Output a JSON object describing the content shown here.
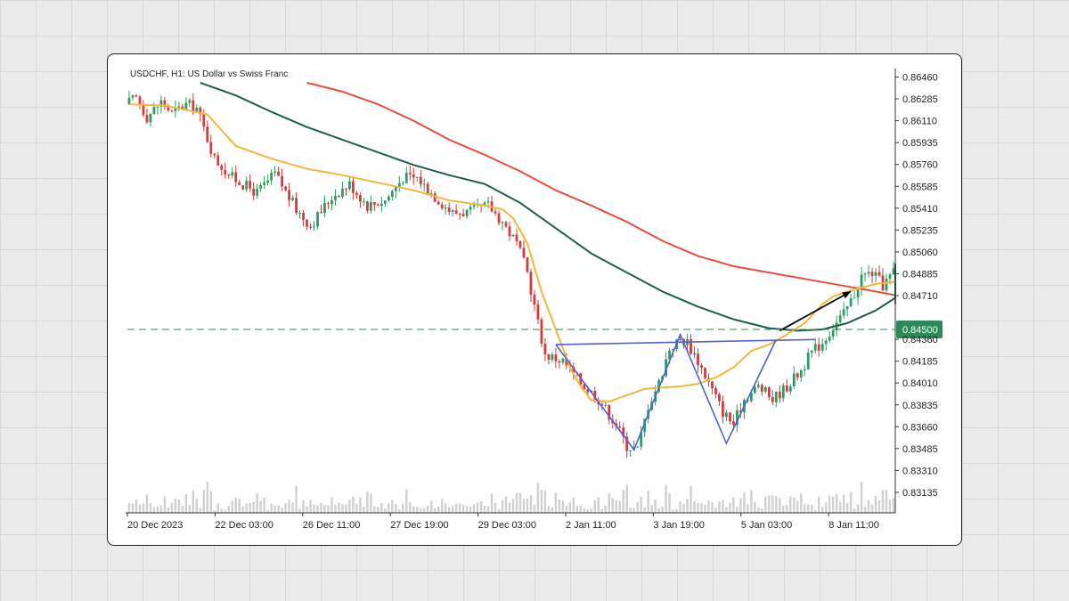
{
  "chart_data": {
    "type": "candlestick",
    "title": "USDCHF, H1: US Dollar vs Swiss Franc",
    "ylim": [
      0.8305,
      0.8652
    ],
    "y_ticks": [
      "0.86460",
      "0.86285",
      "0.86110",
      "0.85935",
      "0.85760",
      "0.85585",
      "0.85410",
      "0.85235",
      "0.85060",
      "0.84885",
      "0.84710",
      "0.84360",
      "0.84185",
      "0.84010",
      "0.83835",
      "0.83660",
      "0.83485",
      "0.83310",
      "0.83135"
    ],
    "x_ticks": [
      "20 Dec 2023",
      "22 Dec 03:00",
      "26 Dec 11:00",
      "27 Dec 19:00",
      "29 Dec 03:00",
      "2 Jan 11:00",
      "3 Jan 19:00",
      "5 Jan 03:00",
      "8 Jan 11:00"
    ],
    "n_bars": 216,
    "support_level": {
      "value": 0.845,
      "label": "0.84500",
      "color": "#2e8b57"
    },
    "colors": {
      "up": "#2e9b63",
      "down": "#d63b3b",
      "volume": "#d0d0d0",
      "ma_fast": "#f4b73a",
      "ma_mid": "#1e5e4b",
      "ma_slow": "#e84d3d",
      "pattern": "#5461d6",
      "arrow": "#000000"
    },
    "anchors": [
      [
        0,
        0.8628
      ],
      [
        3,
        0.8633
      ],
      [
        6,
        0.8618
      ],
      [
        10,
        0.863
      ],
      [
        13,
        0.8621
      ],
      [
        17,
        0.8628
      ],
      [
        20,
        0.8625
      ],
      [
        25,
        0.8585
      ],
      [
        30,
        0.857
      ],
      [
        37,
        0.8558
      ],
      [
        42,
        0.8573
      ],
      [
        48,
        0.8545
      ],
      [
        52,
        0.8532
      ],
      [
        58,
        0.8555
      ],
      [
        63,
        0.8565
      ],
      [
        68,
        0.8548
      ],
      [
        73,
        0.8552
      ],
      [
        78,
        0.857
      ],
      [
        82,
        0.857
      ],
      [
        87,
        0.8555
      ],
      [
        92,
        0.8542
      ],
      [
        97,
        0.8543
      ],
      [
        102,
        0.8548
      ],
      [
        106,
        0.8535
      ],
      [
        110,
        0.8518
      ],
      [
        113,
        0.8495
      ],
      [
        116,
        0.8455
      ],
      [
        118,
        0.843
      ],
      [
        123,
        0.8425
      ],
      [
        128,
        0.8408
      ],
      [
        133,
        0.8395
      ],
      [
        138,
        0.8375
      ],
      [
        141,
        0.8358
      ],
      [
        144,
        0.8355
      ],
      [
        147,
        0.839
      ],
      [
        150,
        0.8408
      ],
      [
        153,
        0.8435
      ],
      [
        156,
        0.8442
      ],
      [
        158,
        0.844
      ],
      [
        161,
        0.8425
      ],
      [
        164,
        0.8408
      ],
      [
        168,
        0.8385
      ],
      [
        171,
        0.8375
      ],
      [
        174,
        0.8395
      ],
      [
        178,
        0.8405
      ],
      [
        182,
        0.8395
      ],
      [
        186,
        0.8405
      ],
      [
        190,
        0.8418
      ],
      [
        193,
        0.8432
      ],
      [
        196,
        0.844
      ],
      [
        199,
        0.8452
      ],
      [
        202,
        0.8462
      ],
      [
        205,
        0.8478
      ],
      [
        207,
        0.8492
      ],
      [
        210,
        0.8495
      ],
      [
        213,
        0.8485
      ],
      [
        216,
        0.8495
      ]
    ],
    "ma_fast": [
      [
        0,
        0.8628
      ],
      [
        10,
        0.8627
      ],
      [
        22,
        0.862
      ],
      [
        30,
        0.8595
      ],
      [
        40,
        0.8585
      ],
      [
        50,
        0.8577
      ],
      [
        60,
        0.8572
      ],
      [
        70,
        0.8566
      ],
      [
        80,
        0.856
      ],
      [
        90,
        0.8552
      ],
      [
        100,
        0.8548
      ],
      [
        105,
        0.8545
      ],
      [
        108,
        0.8538
      ],
      [
        112,
        0.8518
      ],
      [
        116,
        0.848
      ],
      [
        120,
        0.845
      ],
      [
        124,
        0.842
      ],
      [
        127,
        0.8405
      ],
      [
        130,
        0.8394
      ],
      [
        135,
        0.8393
      ],
      [
        140,
        0.8398
      ],
      [
        145,
        0.8403
      ],
      [
        150,
        0.8404
      ],
      [
        155,
        0.8405
      ],
      [
        160,
        0.8407
      ],
      [
        165,
        0.8412
      ],
      [
        170,
        0.842
      ],
      [
        175,
        0.8433
      ],
      [
        180,
        0.8438
      ],
      [
        185,
        0.8446
      ],
      [
        190,
        0.8455
      ],
      [
        195,
        0.847
      ],
      [
        198,
        0.8476
      ],
      [
        202,
        0.848
      ],
      [
        206,
        0.8483
      ],
      [
        210,
        0.8486
      ],
      [
        214,
        0.8487
      ],
      [
        216,
        0.8488
      ]
    ],
    "ma_mid": [
      [
        20,
        0.8645
      ],
      [
        30,
        0.8635
      ],
      [
        40,
        0.8622
      ],
      [
        50,
        0.861
      ],
      [
        60,
        0.86
      ],
      [
        70,
        0.859
      ],
      [
        80,
        0.858
      ],
      [
        90,
        0.8572
      ],
      [
        100,
        0.8565
      ],
      [
        110,
        0.855
      ],
      [
        120,
        0.853
      ],
      [
        130,
        0.851
      ],
      [
        140,
        0.8495
      ],
      [
        150,
        0.848
      ],
      [
        160,
        0.8468
      ],
      [
        170,
        0.8458
      ],
      [
        180,
        0.8451
      ],
      [
        188,
        0.8449
      ],
      [
        195,
        0.845
      ],
      [
        202,
        0.8455
      ],
      [
        210,
        0.8465
      ],
      [
        218,
        0.8475
      ],
      [
        225,
        0.8488
      ],
      [
        232,
        0.8498
      ],
      [
        240,
        0.8502
      ]
    ],
    "ma_slow": [
      [
        50,
        0.8645
      ],
      [
        60,
        0.8638
      ],
      [
        70,
        0.8628
      ],
      [
        80,
        0.8615
      ],
      [
        90,
        0.86
      ],
      [
        100,
        0.8588
      ],
      [
        110,
        0.8575
      ],
      [
        120,
        0.856
      ],
      [
        130,
        0.8548
      ],
      [
        140,
        0.8535
      ],
      [
        150,
        0.852
      ],
      [
        160,
        0.8508
      ],
      [
        170,
        0.85
      ],
      [
        180,
        0.8495
      ],
      [
        190,
        0.849
      ],
      [
        200,
        0.8485
      ],
      [
        210,
        0.848
      ],
      [
        220,
        0.8477
      ],
      [
        230,
        0.8475
      ],
      [
        240,
        0.847
      ]
    ],
    "pattern": {
      "neckline": [
        [
          120,
          0.8438
        ],
        [
          193,
          0.8442
        ]
      ],
      "w_path": [
        [
          120,
          0.8438
        ],
        [
          142,
          0.8355
        ],
        [
          155,
          0.8446
        ],
        [
          168,
          0.836
        ],
        [
          182,
          0.8442
        ]
      ]
    },
    "arrow": {
      "from": [
        183,
        0.8449
      ],
      "to": [
        203,
        0.848
      ]
    }
  }
}
